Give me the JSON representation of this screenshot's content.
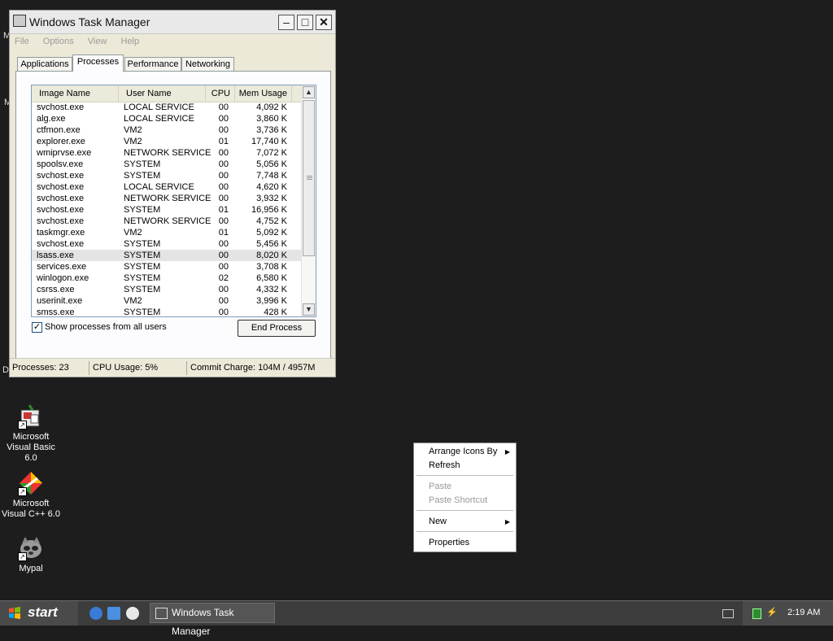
{
  "window": {
    "title": "Windows Task Manager",
    "menu": [
      "File",
      "Options",
      "View",
      "Help"
    ],
    "tabs": [
      "Applications",
      "Processes",
      "Performance",
      "Networking"
    ],
    "active_tab": "Processes",
    "columns": [
      "Image Name",
      "User Name",
      "CPU",
      "Mem Usage"
    ],
    "rows": [
      [
        "svchost.exe",
        "LOCAL SERVICE",
        "00",
        "4,092 K"
      ],
      [
        "alg.exe",
        "LOCAL SERVICE",
        "00",
        "3,860 K"
      ],
      [
        "ctfmon.exe",
        "VM2",
        "00",
        "3,736 K"
      ],
      [
        "explorer.exe",
        "VM2",
        "01",
        "17,740 K"
      ],
      [
        "wmiprvse.exe",
        "NETWORK SERVICE",
        "00",
        "7,072 K"
      ],
      [
        "spoolsv.exe",
        "SYSTEM",
        "00",
        "5,056 K"
      ],
      [
        "svchost.exe",
        "SYSTEM",
        "00",
        "7,748 K"
      ],
      [
        "svchost.exe",
        "LOCAL SERVICE",
        "00",
        "4,620 K"
      ],
      [
        "svchost.exe",
        "NETWORK SERVICE",
        "00",
        "3,932 K"
      ],
      [
        "svchost.exe",
        "SYSTEM",
        "01",
        "16,956 K"
      ],
      [
        "svchost.exe",
        "NETWORK SERVICE",
        "00",
        "4,752 K"
      ],
      [
        "taskmgr.exe",
        "VM2",
        "01",
        "5,092 K"
      ],
      [
        "svchost.exe",
        "SYSTEM",
        "00",
        "5,456 K"
      ],
      [
        "lsass.exe",
        "SYSTEM",
        "00",
        "8,020 K"
      ],
      [
        "services.exe",
        "SYSTEM",
        "00",
        "3,708 K"
      ],
      [
        "winlogon.exe",
        "SYSTEM",
        "02",
        "6,580 K"
      ],
      [
        "csrss.exe",
        "SYSTEM",
        "00",
        "4,332 K"
      ],
      [
        "userinit.exe",
        "VM2",
        "00",
        "3,996 K"
      ],
      [
        "smss.exe",
        "SYSTEM",
        "00",
        "428 K"
      ]
    ],
    "selected_row": 13,
    "show_all_label": "Show processes from all users",
    "show_all_checked": true,
    "end_process_label": "End Process",
    "status": {
      "processes": "Processes: 23",
      "cpu": "CPU Usage: 5%",
      "commit": "Commit Charge: 104M / 4957M"
    }
  },
  "desktop": {
    "icons": [
      {
        "label": "Microsoft Visual Basic 6.0",
        "icon": "vb6-icon"
      },
      {
        "label": "Microsoft Visual C++ 6.0",
        "icon": "vc6-icon"
      },
      {
        "label": "Mypal",
        "icon": "mypal-icon"
      }
    ],
    "edge_letters": [
      "M",
      "M",
      "D"
    ]
  },
  "context_menu": {
    "items": [
      {
        "label": "Arrange Icons By",
        "submenu": true,
        "disabled": false
      },
      {
        "label": "Refresh",
        "submenu": false,
        "disabled": false
      },
      {
        "label": "Paste",
        "submenu": false,
        "disabled": true
      },
      {
        "label": "Paste Shortcut",
        "submenu": false,
        "disabled": true
      },
      {
        "label": "New",
        "submenu": true,
        "disabled": false
      },
      {
        "label": "Properties",
        "submenu": false,
        "disabled": false
      }
    ]
  },
  "taskbar": {
    "start_label": "start",
    "task_label": "Windows Task Manager",
    "clock": "2:19 AM"
  }
}
